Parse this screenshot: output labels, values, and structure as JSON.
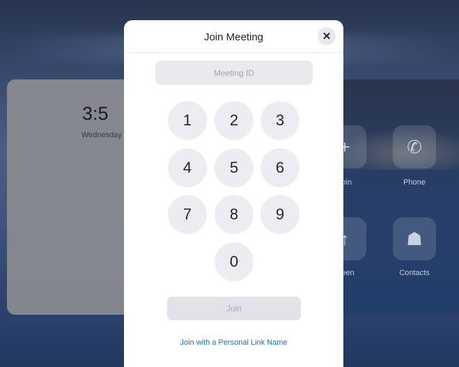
{
  "background": {
    "clock": {
      "time": "3:5",
      "day": "Wednesday"
    },
    "tiles": [
      {
        "label": "Join",
        "icon": "plus-icon",
        "glyph": "+"
      },
      {
        "label": "Phone",
        "icon": "phone-icon",
        "glyph": "✆"
      },
      {
        "label": "Share Screen",
        "icon": "share-screen-icon",
        "glyph": "↑"
      },
      {
        "label": "Contacts",
        "icon": "contacts-icon",
        "glyph": "☗"
      }
    ]
  },
  "modal": {
    "title": "Join Meeting",
    "close_glyph": "✕",
    "meeting_id": {
      "value": "",
      "placeholder": "Meeting ID"
    },
    "keypad": [
      "1",
      "2",
      "3",
      "4",
      "5",
      "6",
      "7",
      "8",
      "9",
      "0"
    ],
    "join_label": "Join",
    "personal_link_label": "Join with a Personal Link Name"
  },
  "colors": {
    "accent": "#0e71eb",
    "key_bg": "#ededf1"
  }
}
